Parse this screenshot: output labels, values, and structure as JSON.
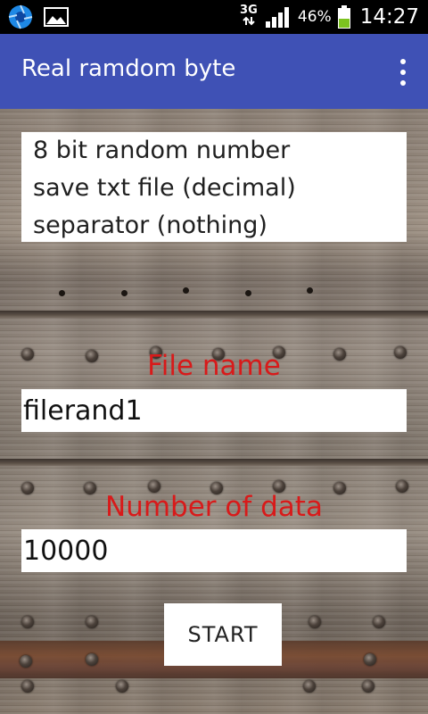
{
  "status_bar": {
    "network_type": "3G",
    "battery_percent": "46%",
    "battery_level": 0.46,
    "time": "14:27",
    "icons": [
      "aperture-app-icon",
      "gallery-image-icon",
      "network-arrows-icon",
      "cell-signal-icon",
      "battery-icon"
    ]
  },
  "app_bar": {
    "title": "Real ramdom byte",
    "menu_icon": "overflow-menu-icon"
  },
  "info": {
    "lines": [
      "8 bit random number",
      "save txt file (decimal)",
      "separator (nothing)"
    ]
  },
  "file": {
    "label": "File name",
    "value": "filerand1"
  },
  "count": {
    "label": "Number of data",
    "value": "10000"
  },
  "start_button": {
    "label": "START"
  },
  "colors": {
    "app_bar": "#3f51b5",
    "label_red": "#d81a1a",
    "battery_green": "#7cc31f"
  }
}
